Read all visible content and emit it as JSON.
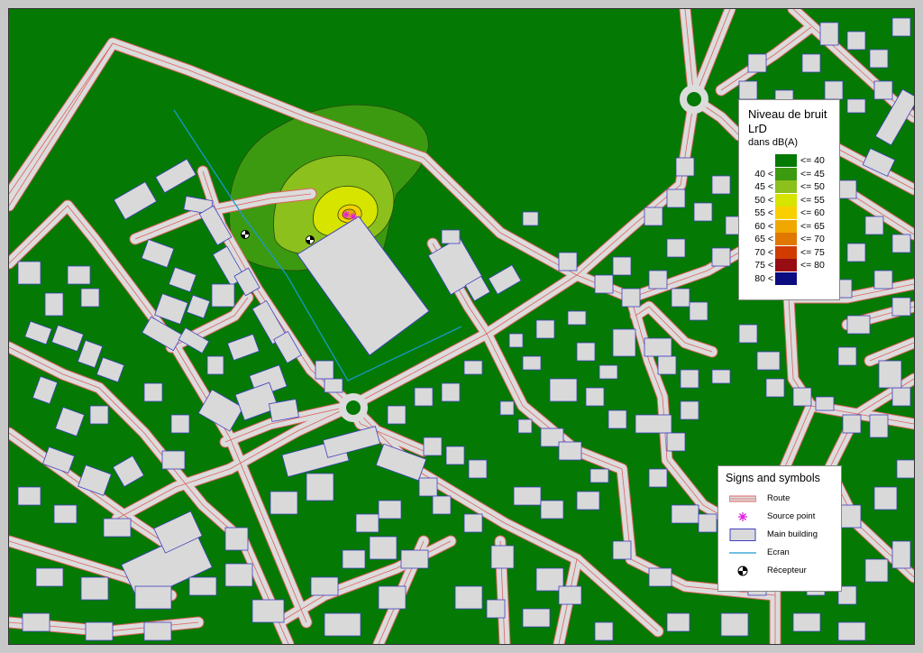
{
  "legend": {
    "title_line1": "Niveau de bruit",
    "title_line2": "LrD",
    "unit": "dans dB(A)",
    "scale": [
      {
        "lower": "",
        "upper": "<= 40",
        "color": "#047a04"
      },
      {
        "lower": "40 <",
        "upper": "<= 45",
        "color": "#3c9a10"
      },
      {
        "lower": "45 <",
        "upper": "<= 50",
        "color": "#8cc01c"
      },
      {
        "lower": "50 <",
        "upper": "<= 55",
        "color": "#d6e400"
      },
      {
        "lower": "55 <",
        "upper": "<= 60",
        "color": "#f8d000"
      },
      {
        "lower": "60 <",
        "upper": "<= 65",
        "color": "#f0a800"
      },
      {
        "lower": "65 <",
        "upper": "<= 70",
        "color": "#e07800"
      },
      {
        "lower": "70 <",
        "upper": "<= 75",
        "color": "#d03c00"
      },
      {
        "lower": "75 <",
        "upper": "<= 80",
        "color": "#980c14"
      },
      {
        "lower": "80 <",
        "upper": "",
        "color": "#0c0c80"
      }
    ]
  },
  "signs": {
    "title": "Signs and symbols",
    "items": [
      {
        "label": "Route",
        "icon": "route-icon"
      },
      {
        "label": "Source point",
        "icon": "source-point-icon"
      },
      {
        "label": "Main building",
        "icon": "main-building-icon"
      },
      {
        "label": "Ecran",
        "icon": "ecran-icon"
      },
      {
        "label": "Récepteur",
        "icon": "recepteur-icon"
      }
    ]
  },
  "colors": {
    "ground": "#047a04",
    "road_fill": "#dcdcdc",
    "road_edge": "#e06060",
    "building_fill": "#d9d9d9",
    "building_edge": "#4040c0",
    "screen": "#1a9ad6",
    "source": "#e020e0"
  }
}
